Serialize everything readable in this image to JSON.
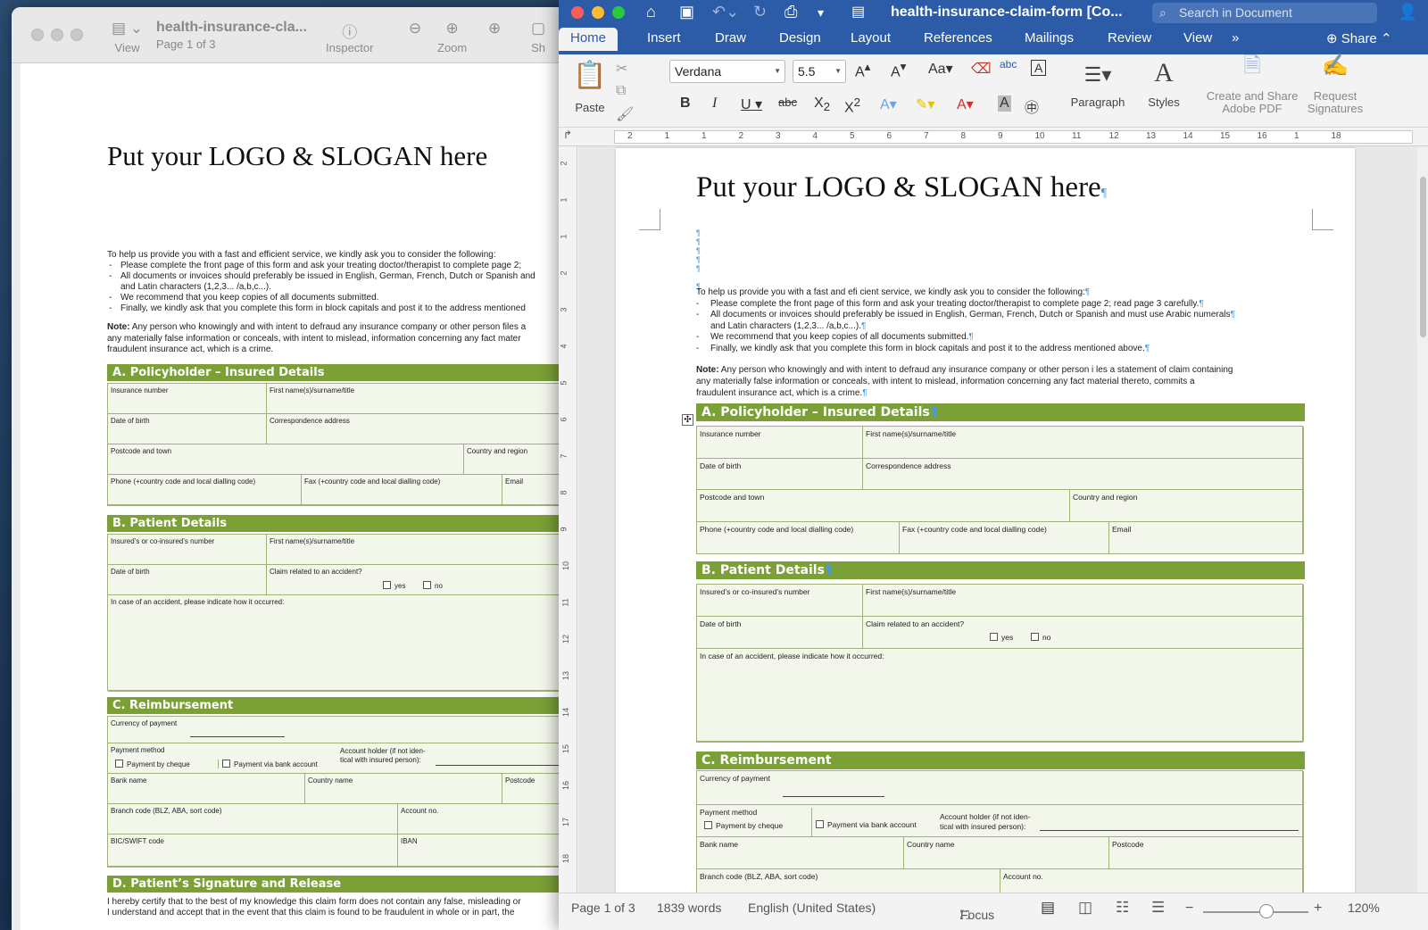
{
  "preview": {
    "view_label": "View",
    "title": "health-insurance-cla...",
    "page_label": "Page 1 of 3",
    "inspector_label": "Inspector",
    "zoom_label": "Zoom",
    "share_label": "Sh",
    "logo": "Put your LOGO & SLOGAN here",
    "intro": "To help us provide you with a fast and efficient service, we kindly ask you to consider the following:",
    "bullets": [
      "Please complete the front page of this form and ask your treating doctor/therapist to complete page 2;",
      "All documents or invoices should preferably be issued in English, German, French, Dutch or Spanish and",
      "and Latin characters (1,2,3... /a,b,c...).",
      "We recommend that you keep copies of all documents submitted.",
      "Finally, we kindly ask that you complete this form in block capitals and post it to the address mentioned"
    ],
    "note_label": "Note:",
    "note_lines": [
      " Any person who knowingly and with intent to defraud any insurance company or other person files a",
      "any materially false information or conceals, with intent to mislead, information concerning any fact mater",
      "fraudulent insurance act, which is a crime."
    ],
    "sec_a": "A.  Policyholder – Insured Details",
    "sec_b": "B.  Patient Details",
    "sec_c": "C.  Reimbursement",
    "sec_d": "D.  Patient’s Signature and Release",
    "d_line1": "I hereby certify that to the best of my knowledge this claim form does not contain any false, misleading or",
    "d_line2": "I understand and accept that in the event that this claim is found to be fraudulent in whole or in part, the",
    "fields": {
      "insurance_number": "Insurance number",
      "first_names": "First name(s)/surname/title",
      "dob": "Date of birth",
      "correspondence": "Correspondence address",
      "postcode_town": "Postcode and town",
      "country_region": "Country and region",
      "phone": "Phone (+country code and local dialling code)",
      "fax": "Fax (+country code and local dialling code)",
      "email": "Email",
      "insured_number": "Insured’s or co-insured’s number",
      "claim_accident": "Claim related to an accident?",
      "yes": "yes",
      "no": "no",
      "accident_how": "In case of an accident, please indicate how it occurred:",
      "currency": "Currency of payment",
      "payment_method": "Payment method",
      "by_cheque": "Payment by cheque",
      "via_bank": "Payment via bank account",
      "account_holder_1": "Account holder (if not iden-",
      "account_holder_2": "tical with insured person):",
      "bank_name": "Bank name",
      "country_name": "Country name",
      "postcode": "Postcode",
      "branch_code": "Branch code (BLZ, ABA, sort code)",
      "account_no": "Account no.",
      "bic": "BIC/SWIFT code",
      "iban": "IBAN"
    }
  },
  "word": {
    "doc_title": "health-insurance-claim-form [Co...",
    "search_placeholder": "Search in Document",
    "tabs": [
      "Home",
      "Insert",
      "Draw",
      "Design",
      "Layout",
      "References",
      "Mailings",
      "Review",
      "View"
    ],
    "more_tabs": "»",
    "share_label": "Share",
    "ribbon": {
      "paste": "Paste",
      "font": "Verdana",
      "size": "5.5",
      "paragraph": "Paragraph",
      "styles": "Styles",
      "create_share_1": "Create and Share",
      "create_share_2": "Adobe PDF",
      "request_1": "Request",
      "request_2": "Signatures"
    },
    "ruler_nums": [
      "2",
      "1",
      "1",
      "2",
      "3",
      "4",
      "5",
      "6",
      "7",
      "8",
      "9",
      "10",
      "11",
      "12",
      "13",
      "14",
      "15",
      "16",
      "1",
      "18"
    ],
    "vruler_nums": [
      "2",
      "1",
      "1",
      "2",
      "3",
      "4",
      "5",
      "6",
      "7",
      "8",
      "9",
      "10",
      "11",
      "12",
      "13",
      "14",
      "15",
      "16",
      "17",
      "18"
    ],
    "logo": "Put your LOGO & SLOGAN here",
    "intro": "To help us provide you with a fast and efi cient service, we kindly ask you to consider the following:",
    "bullets": [
      "Please complete the front page of this form and ask your treating doctor/therapist to complete page 2; read page 3 carefully.",
      "All documents or invoices should preferably be issued in English, German, French, Dutch or Spanish and must use Arabic numerals",
      "and Latin characters (1,2,3... /a,b,c...).",
      "We recommend that you keep copies of all documents submitted.",
      "Finally, we kindly ask that you complete this form in block capitals and post it to the address mentioned above."
    ],
    "note_label": "Note:",
    "note_lines": [
      " Any person who knowingly and with intent to defraud any insurance company or other person i les a statement of claim containing",
      "any materially false information or conceals, with intent to mislead, information concerning any fact material thereto, commits a",
      "fraudulent insurance act, which is a crime."
    ],
    "sec_a": "A.  Policyholder – Insured Details",
    "sec_b": "B.  Patient Details",
    "sec_c": "C.  Reimbursement",
    "status": {
      "page": "Page 1 of 3",
      "words": "1839 words",
      "language": "English (United States)",
      "focus": "Focus",
      "zoom": "120%"
    }
  },
  "colors": {
    "section_green": "#7aa036",
    "word_blue": "#2c5ba7"
  }
}
